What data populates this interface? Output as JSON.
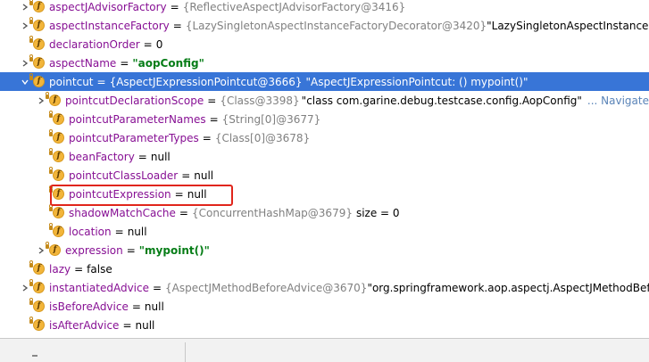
{
  "rows": [
    {
      "expand": true,
      "field": "aspectJAdvisorFactory",
      "type": "{ReflectiveAspectJAdvisorFactory@3416}",
      "extra": "",
      "nav": ""
    },
    {
      "expand": true,
      "field": "aspectInstanceFactory",
      "type": "{LazySingletonAspectInstanceFactoryDecorator@3420}",
      "extra": "\"LazySingletonAspectInstanceFactor",
      "nav": ""
    },
    {
      "expand": false,
      "field": "declarationOrder",
      "type": "",
      "extra": "0",
      "nav": ""
    },
    {
      "expand": true,
      "field": "aspectName",
      "type": "",
      "extra": "\"aopConfig\"",
      "nav": ""
    },
    {
      "expand": "open",
      "field": "pointcut",
      "type": "{AspectJExpressionPointcut@3666}",
      "extra": "\"AspectJExpressionPointcut: () mypoint()\"",
      "nav": ""
    },
    {
      "expand": true,
      "field": "pointcutDeclarationScope",
      "type": "{Class@3398}",
      "extra": "\"class com.garine.debug.testcase.config.AopConfig\"",
      "nav": "... Navigate"
    },
    {
      "expand": false,
      "field": "pointcutParameterNames",
      "type": "{String[0]@3677}",
      "extra": "",
      "nav": ""
    },
    {
      "expand": false,
      "field": "pointcutParameterTypes",
      "type": "{Class[0]@3678}",
      "extra": "",
      "nav": ""
    },
    {
      "expand": false,
      "field": "beanFactory",
      "type": "",
      "extra": "null",
      "nav": ""
    },
    {
      "expand": false,
      "field": "pointcutClassLoader",
      "type": "",
      "extra": "null",
      "nav": ""
    },
    {
      "expand": false,
      "field": "pointcutExpression",
      "type": "",
      "extra": "null",
      "nav": ""
    },
    {
      "expand": false,
      "field": "shadowMatchCache",
      "type": "{ConcurrentHashMap@3679}",
      "extra": "size = 0",
      "nav": ""
    },
    {
      "expand": false,
      "field": "location",
      "type": "",
      "extra": "null",
      "nav": ""
    },
    {
      "expand": true,
      "field": "expression",
      "type": "",
      "extra": "\"mypoint()\"",
      "nav": ""
    },
    {
      "expand": false,
      "field": "lazy",
      "type": "",
      "extra": "false",
      "nav": ""
    },
    {
      "expand": true,
      "field": "instantiatedAdvice",
      "type": "{AspectJMethodBeforeAdvice@3670}",
      "extra": "\"org.springframework.aop.aspectj.AspectJMethodBefore",
      "nav": ""
    },
    {
      "expand": false,
      "field": "isBeforeAdvice",
      "type": "",
      "extra": "null",
      "nav": ""
    },
    {
      "expand": false,
      "field": "isAfterAdvice",
      "type": "",
      "extra": "null",
      "nav": ""
    }
  ],
  "equals": "=",
  "field_icon_letter": "f",
  "colors": {
    "selection": "#3875d7",
    "field_name": "#871094",
    "type_ref": "#808080",
    "string": "#067d17",
    "navigate": "#5a84b8",
    "highlight_box": "#e0251b"
  }
}
